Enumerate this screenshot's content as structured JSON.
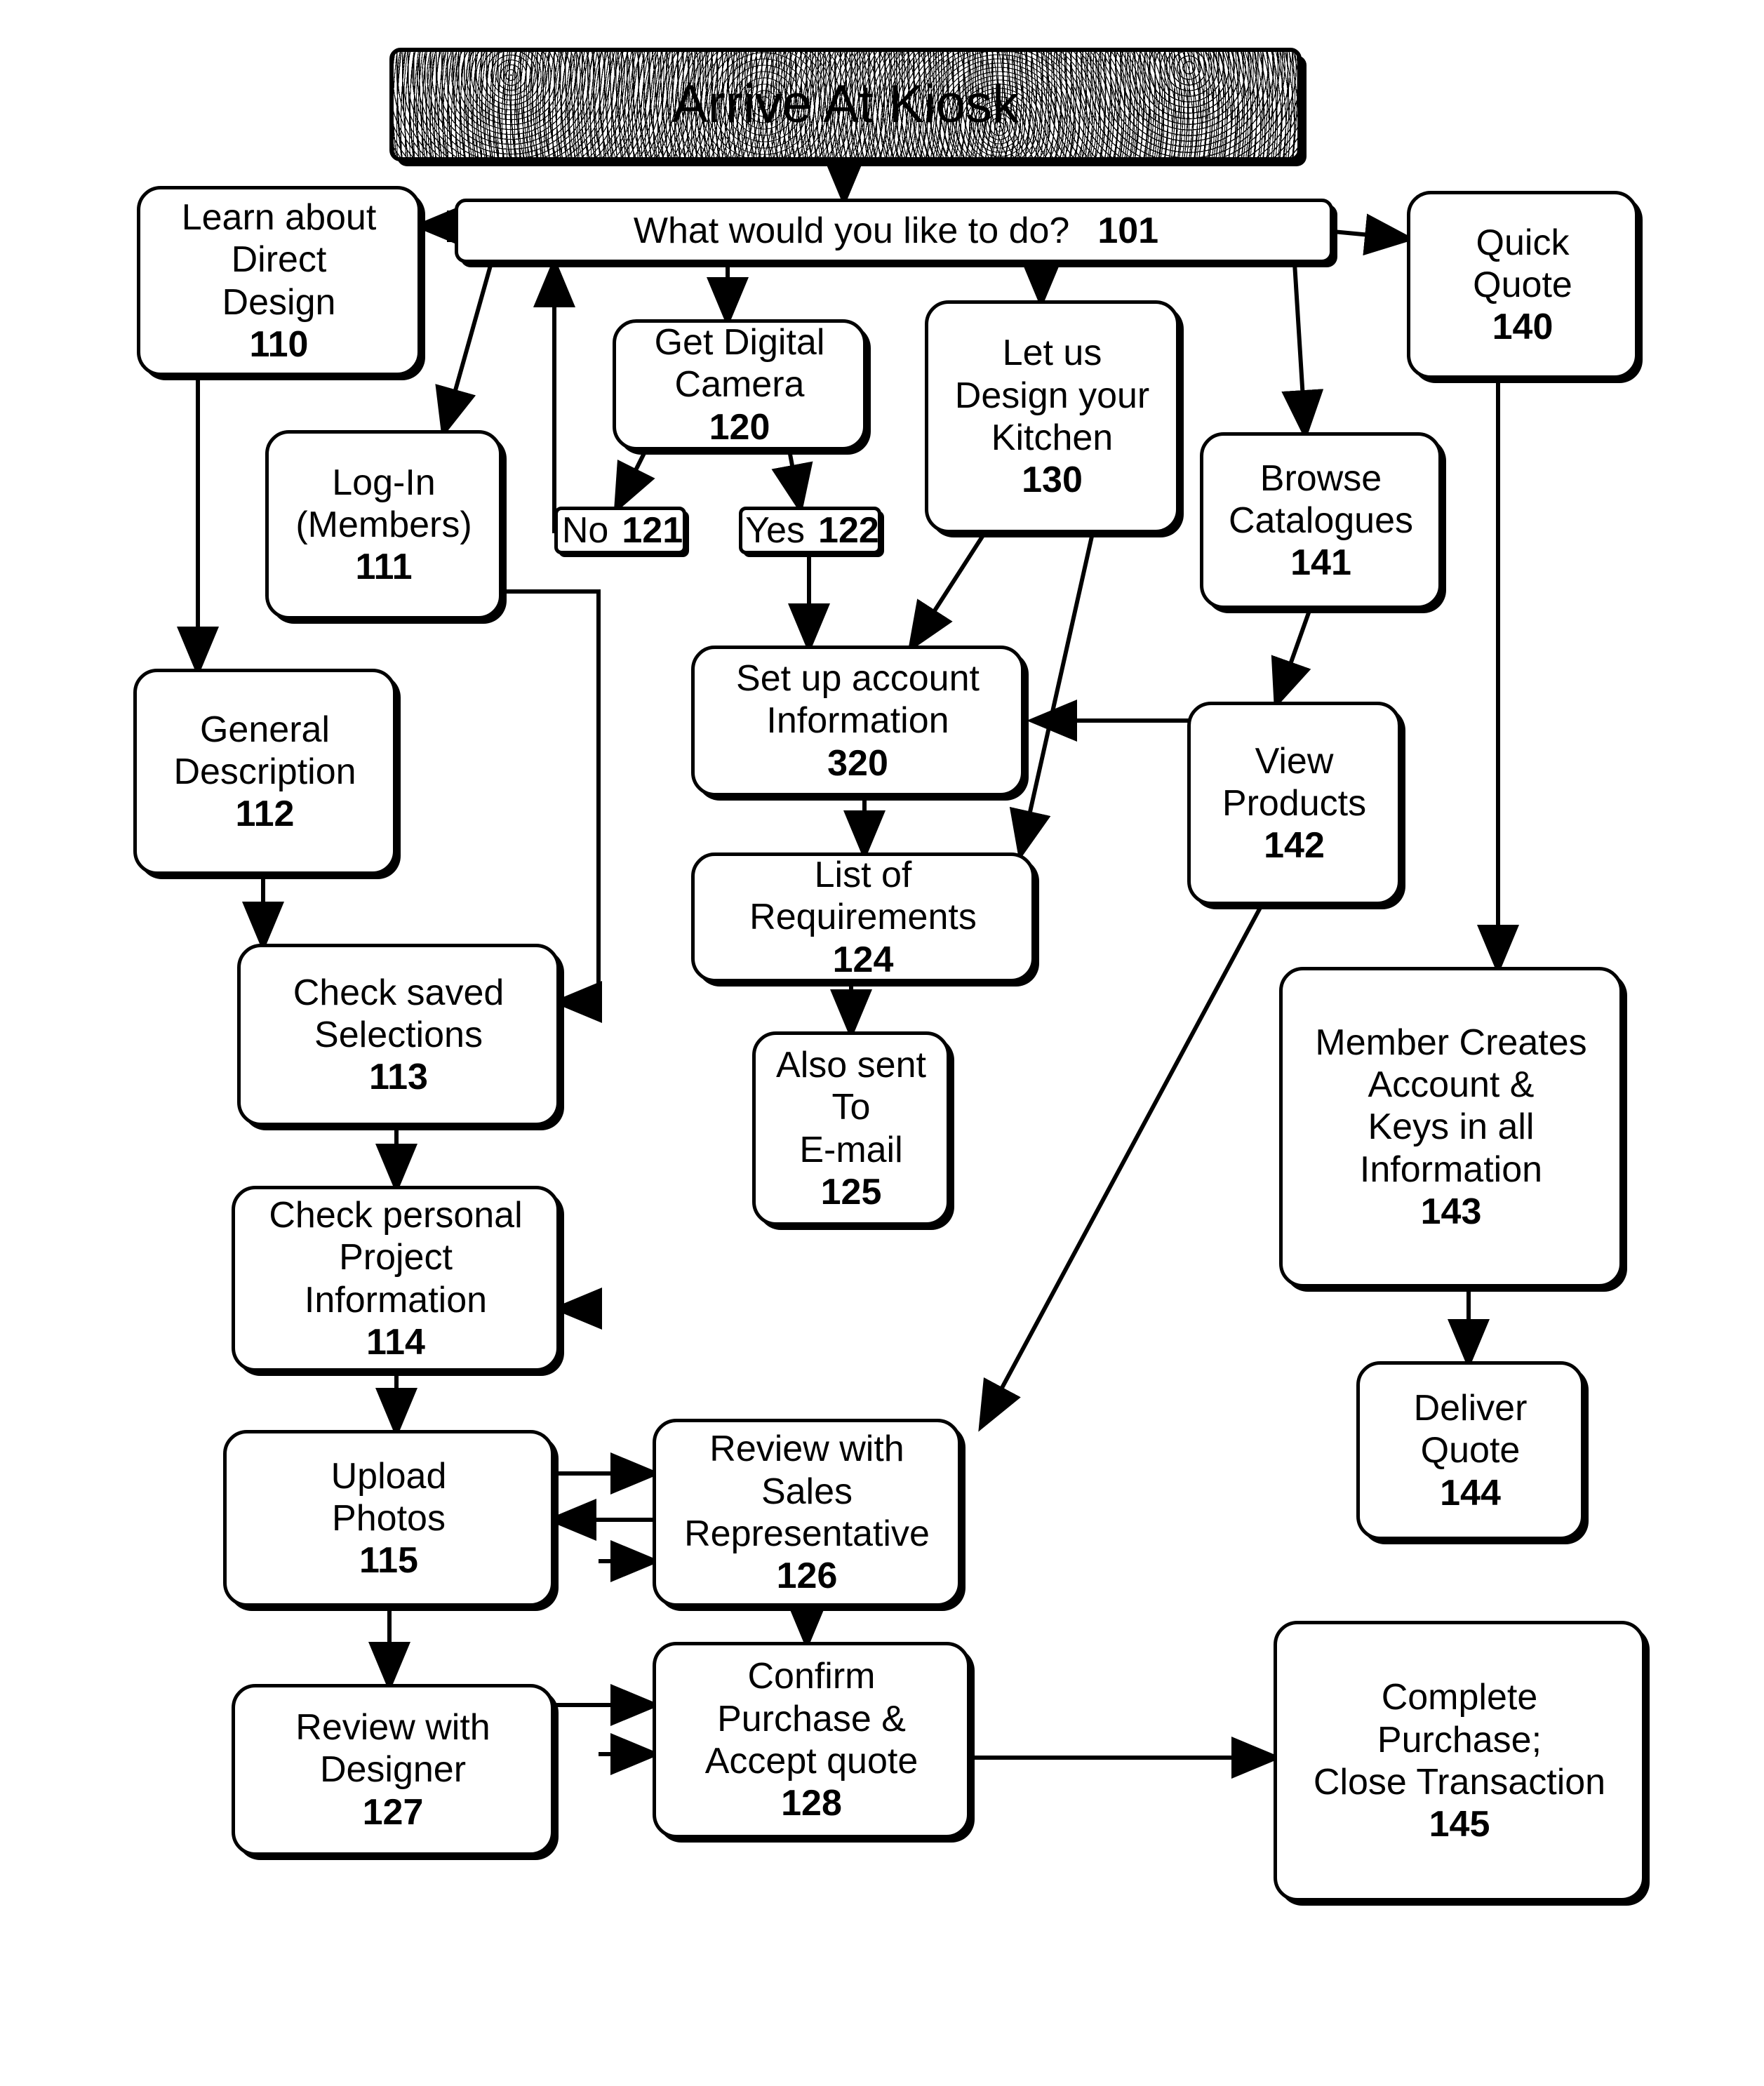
{
  "diagram": {
    "title": "Arrive At Kiosk",
    "nodes": [
      {
        "id": "kiosk",
        "label": "Arrive At Kiosk",
        "ref": ""
      },
      {
        "id": "prompt",
        "label": "What would you like to do?",
        "ref": "101"
      },
      {
        "id": "learn",
        "label": "Learn about\nDirect\nDesign",
        "ref": "110"
      },
      {
        "id": "login",
        "label": "Log-In\n(Members)",
        "ref": "111"
      },
      {
        "id": "general",
        "label": "General\nDescription",
        "ref": "112"
      },
      {
        "id": "saved",
        "label": "Check saved\nSelections",
        "ref": "113"
      },
      {
        "id": "personal",
        "label": "Check personal\nProject\nInformation",
        "ref": "114"
      },
      {
        "id": "upload",
        "label": "Upload\nPhotos",
        "ref": "115"
      },
      {
        "id": "camera",
        "label": "Get Digital\nCamera",
        "ref": "120"
      },
      {
        "id": "no",
        "label": "No",
        "ref": "121"
      },
      {
        "id": "yes",
        "label": "Yes",
        "ref": "122"
      },
      {
        "id": "requirements",
        "label": "List of\nRequirements",
        "ref": "124"
      },
      {
        "id": "email",
        "label": "Also sent\nTo\nE-mail",
        "ref": "125"
      },
      {
        "id": "sales",
        "label": "Review with\nSales\nRepresentative",
        "ref": "126"
      },
      {
        "id": "designer",
        "label": "Review with\nDesigner",
        "ref": "127"
      },
      {
        "id": "confirm",
        "label": "Confirm\nPurchase &\nAccept quote",
        "ref": "128"
      },
      {
        "id": "kitchen",
        "label": "Let us\nDesign your\nKitchen",
        "ref": "130"
      },
      {
        "id": "quickquote",
        "label": "Quick\nQuote",
        "ref": "140"
      },
      {
        "id": "catalogues",
        "label": "Browse\nCatalogues",
        "ref": "141"
      },
      {
        "id": "products",
        "label": "View\nProducts",
        "ref": "142"
      },
      {
        "id": "member",
        "label": "Member Creates\nAccount &\nKeys in all\nInformation",
        "ref": "143"
      },
      {
        "id": "deliver",
        "label": "Deliver\nQuote",
        "ref": "144"
      },
      {
        "id": "complete",
        "label": "Complete\nPurchase;\nClose Transaction",
        "ref": "145"
      },
      {
        "id": "account",
        "label": "Set up account\nInformation",
        "ref": "320"
      }
    ],
    "edges": [
      {
        "from": "kiosk",
        "to": "prompt"
      },
      {
        "from": "prompt",
        "to": "learn"
      },
      {
        "from": "prompt",
        "to": "login"
      },
      {
        "from": "prompt",
        "to": "camera"
      },
      {
        "from": "prompt",
        "to": "kitchen"
      },
      {
        "from": "prompt",
        "to": "catalogues"
      },
      {
        "from": "prompt",
        "to": "quickquote"
      },
      {
        "from": "learn",
        "to": "general"
      },
      {
        "from": "general",
        "to": "saved"
      },
      {
        "from": "login",
        "to": "saved"
      },
      {
        "from": "saved",
        "to": "personal"
      },
      {
        "from": "personal",
        "to": "upload"
      },
      {
        "from": "upload",
        "to": "sales"
      },
      {
        "from": "sales",
        "to": "upload"
      },
      {
        "from": "upload",
        "to": "designer"
      },
      {
        "from": "designer",
        "to": "confirm"
      },
      {
        "from": "sales",
        "to": "confirm"
      },
      {
        "from": "confirm",
        "to": "complete"
      },
      {
        "from": "camera",
        "to": "no"
      },
      {
        "from": "camera",
        "to": "yes"
      },
      {
        "from": "no",
        "to": "prompt"
      },
      {
        "from": "yes",
        "to": "account"
      },
      {
        "from": "kitchen",
        "to": "account"
      },
      {
        "from": "kitchen",
        "to": "requirements"
      },
      {
        "from": "account",
        "to": "requirements"
      },
      {
        "from": "requirements",
        "to": "email"
      },
      {
        "from": "catalogues",
        "to": "products"
      },
      {
        "from": "products",
        "to": "account"
      },
      {
        "from": "products",
        "to": "sales"
      },
      {
        "from": "quickquote",
        "to": "member"
      },
      {
        "from": "member",
        "to": "deliver"
      }
    ]
  }
}
